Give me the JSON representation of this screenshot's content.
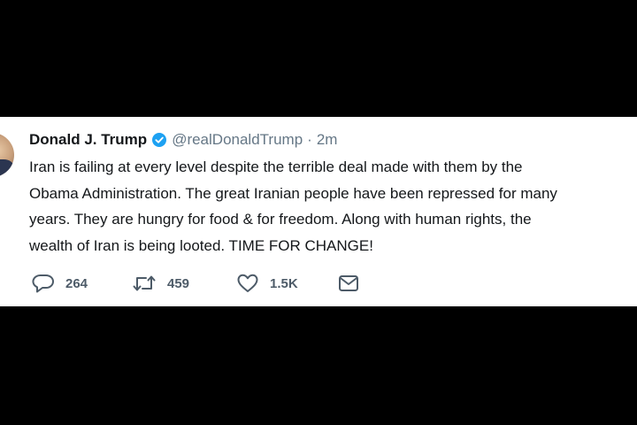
{
  "tweet": {
    "author": {
      "display_name": "Donald J. Trump",
      "handle": "@realDonaldTrump",
      "verified": true
    },
    "separator": "·",
    "time": "2m",
    "text_lines": [
      "Iran is failing at every level despite the terrible deal made with them by the",
      "Obama Administration. The great Iranian people have been repressed for many",
      "years. They are hungry for food & for freedom. Along with human rights, the",
      "wealth of Iran is being looted. TIME FOR CHANGE!"
    ],
    "actions": {
      "replies": "264",
      "retweets": "459",
      "likes": "1.5K"
    }
  },
  "colors": {
    "background": "#000000",
    "card": "#ffffff",
    "text": "#14171a",
    "secondary_text": "#657786",
    "verified_blue": "#1da1f2",
    "icon": "#4d5b68"
  },
  "icons": {
    "verified": "verified-badge-icon",
    "reply": "reply-icon",
    "retweet": "retweet-icon",
    "like": "heart-icon",
    "direct_message": "envelope-icon"
  }
}
